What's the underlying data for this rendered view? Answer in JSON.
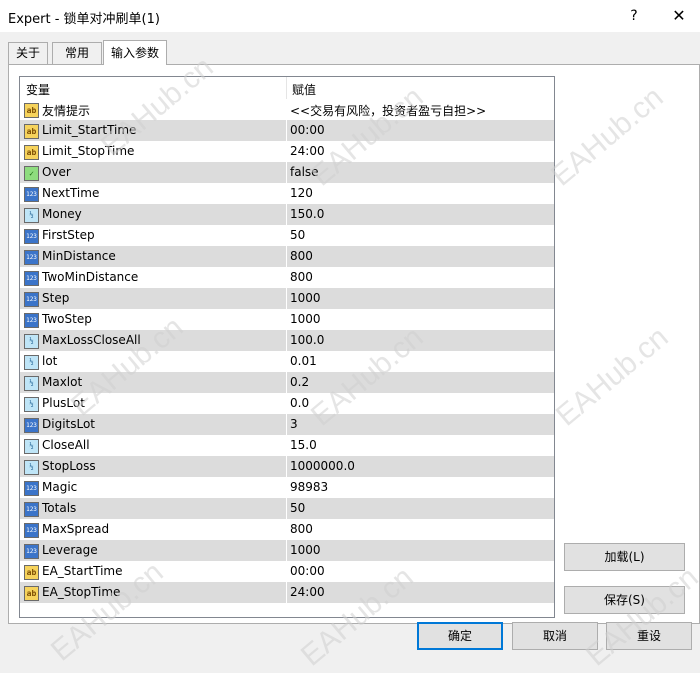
{
  "window": {
    "title": "Expert - 锁单对冲刷单(1)",
    "help_label": "?",
    "close_label": "✕"
  },
  "tabs": [
    {
      "label": "关于"
    },
    {
      "label": "常用"
    },
    {
      "label": "输入参数"
    }
  ],
  "table": {
    "col_variable": "变量",
    "col_value": "赋值",
    "rows": [
      {
        "name": "友情提示",
        "value": "<<交易有风险，投资者盈亏自担>>",
        "icon": "ab"
      },
      {
        "name": "Limit_StartTime",
        "value": "00:00",
        "icon": "ab"
      },
      {
        "name": "Limit_StopTime",
        "value": "24:00",
        "icon": "ab"
      },
      {
        "name": "Over",
        "value": "false",
        "icon": "bool"
      },
      {
        "name": "NextTime",
        "value": "120",
        "icon": "123"
      },
      {
        "name": "Money",
        "value": "150.0",
        "icon": "half"
      },
      {
        "name": "FirstStep",
        "value": "50",
        "icon": "123"
      },
      {
        "name": "MinDistance",
        "value": "800",
        "icon": "123"
      },
      {
        "name": "TwoMinDistance",
        "value": "800",
        "icon": "123"
      },
      {
        "name": "Step",
        "value": "1000",
        "icon": "123"
      },
      {
        "name": "TwoStep",
        "value": "1000",
        "icon": "123"
      },
      {
        "name": "MaxLossCloseAll",
        "value": "100.0",
        "icon": "half"
      },
      {
        "name": "lot",
        "value": "0.01",
        "icon": "half"
      },
      {
        "name": "Maxlot",
        "value": "0.2",
        "icon": "half"
      },
      {
        "name": "PlusLot",
        "value": "0.0",
        "icon": "half"
      },
      {
        "name": "DigitsLot",
        "value": "3",
        "icon": "123"
      },
      {
        "name": "CloseAll",
        "value": "15.0",
        "icon": "half"
      },
      {
        "name": "StopLoss",
        "value": "1000000.0",
        "icon": "half"
      },
      {
        "name": "Magic",
        "value": "98983",
        "icon": "123"
      },
      {
        "name": "Totals",
        "value": "50",
        "icon": "123"
      },
      {
        "name": "MaxSpread",
        "value": "800",
        "icon": "123"
      },
      {
        "name": "Leverage",
        "value": "1000",
        "icon": "123"
      },
      {
        "name": "EA_StartTime",
        "value": "00:00",
        "icon": "ab"
      },
      {
        "name": "EA_StopTime",
        "value": "24:00",
        "icon": "ab"
      }
    ]
  },
  "buttons": {
    "load": "加载(L)",
    "save": "保存(S)",
    "ok": "确定",
    "cancel": "取消",
    "reset": "重设"
  },
  "watermark": "EAHub.cn"
}
